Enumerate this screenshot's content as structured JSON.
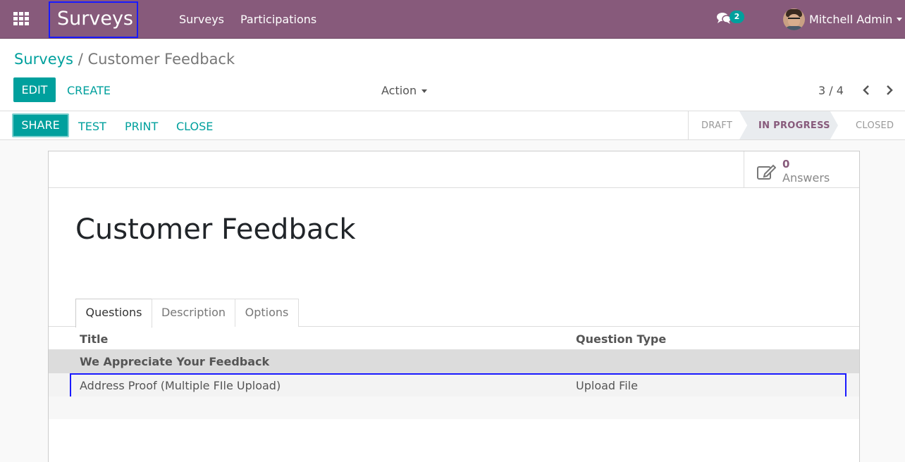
{
  "navbar": {
    "brand": "Surveys",
    "menu": [
      "Surveys",
      "Participations"
    ],
    "chat_count": "2",
    "user_name": "Mitchell Admin"
  },
  "breadcrumb": {
    "root": "Surveys",
    "separator": "/",
    "current": "Customer Feedback"
  },
  "buttons": {
    "edit": "EDIT",
    "create": "CREATE",
    "action": "Action"
  },
  "pager": {
    "value": "3 / 4"
  },
  "statusbar": {
    "share": "SHARE",
    "test": "TEST",
    "print": "PRINT",
    "close": "CLOSE",
    "stages": [
      "DRAFT",
      "IN PROGRESS",
      "CLOSED"
    ],
    "active_stage": "IN PROGRESS"
  },
  "sheet": {
    "stat_value": "0",
    "stat_label": "Answers",
    "title": "Customer Feedback",
    "tabs": [
      "Questions",
      "Description",
      "Options"
    ],
    "active_tab": "Questions"
  },
  "table": {
    "headers": [
      "Title",
      "Question Type"
    ],
    "section": "We Appreciate Your Feedback",
    "rows": [
      {
        "title": "Address Proof (Multiple FIle Upload)",
        "type": "Upload File"
      }
    ]
  },
  "colors": {
    "brand": "#875a7b",
    "accent": "#00a09d",
    "highlight": "#1a1aff"
  }
}
